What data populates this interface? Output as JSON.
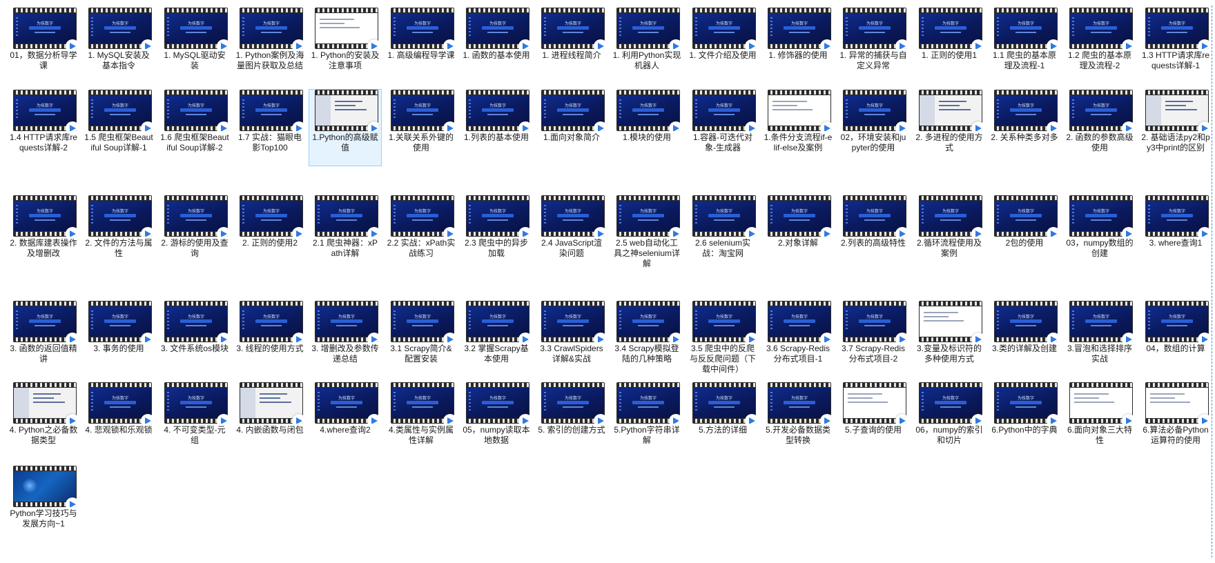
{
  "files": [
    {
      "name": "01，数据分析导学课",
      "thumb": "slide"
    },
    {
      "name": "1. MySQL安装及基本指令",
      "thumb": "slide"
    },
    {
      "name": "1. MySQL驱动安装",
      "thumb": "slide"
    },
    {
      "name": "1. Python案例及海量图片获取及总结",
      "thumb": "slide"
    },
    {
      "name": "1. Python的安装及注意事项",
      "thumb": "doc"
    },
    {
      "name": "1. 高级编程导学课",
      "thumb": "slide"
    },
    {
      "name": "1. 函数的基本使用",
      "thumb": "slide"
    },
    {
      "name": "1. 进程线程简介",
      "thumb": "slide"
    },
    {
      "name": "1. 利用Python实现机器人",
      "thumb": "slide"
    },
    {
      "name": "1. 文件介绍及使用",
      "thumb": "slide"
    },
    {
      "name": "1. 修饰器的使用",
      "thumb": "slide"
    },
    {
      "name": "1. 异常的捕获与自定义异常",
      "thumb": "slide"
    },
    {
      "name": "1. 正则的使用1",
      "thumb": "slide"
    },
    {
      "name": "1.1 爬虫的基本原理及流程-1",
      "thumb": "slide"
    },
    {
      "name": "1.2 爬虫的基本原理及流程-2",
      "thumb": "slide"
    },
    {
      "name": "1.3 HTTP请求库requests详解-1",
      "thumb": "slide"
    },
    {
      "name": "1.4 HTTP请求库requests详解-2",
      "thumb": "slide"
    },
    {
      "name": "1.5 爬虫框架Beautiful Soup详解-1",
      "thumb": "slide"
    },
    {
      "name": "1.6 爬虫框架Beautiful Soup详解-2",
      "thumb": "slide"
    },
    {
      "name": "1.7 实战：猫眼电影Top100",
      "thumb": "slide"
    },
    {
      "name": "1.Python的高级赋值",
      "thumb": "split",
      "selected": true
    },
    {
      "name": "1.关联关系外键的使用",
      "thumb": "slide"
    },
    {
      "name": "1.列表的基本使用",
      "thumb": "slide"
    },
    {
      "name": "1.面向对象简介",
      "thumb": "slide"
    },
    {
      "name": "1.模块的使用",
      "thumb": "slide"
    },
    {
      "name": "1.容器-可迭代对象-生成器",
      "thumb": "slide"
    },
    {
      "name": "1.条件分支流程if-elif-else及案例",
      "thumb": "doc"
    },
    {
      "name": "02，环境安装和jupyter的使用",
      "thumb": "slide"
    },
    {
      "name": "2. 多进程的使用方式",
      "thumb": "split"
    },
    {
      "name": "2. 关系种类多对多",
      "thumb": "slide"
    },
    {
      "name": "2. 函数的参数高级使用",
      "thumb": "slide"
    },
    {
      "name": "2. 基础语法py2和py3中print的区别",
      "thumb": "split"
    },
    {
      "name": "2. 数据库建表操作及增删改",
      "thumb": "slide"
    },
    {
      "name": "2. 文件的方法与属性",
      "thumb": "slide"
    },
    {
      "name": "2. 游标的使用及查询",
      "thumb": "slide"
    },
    {
      "name": "2. 正则的使用2",
      "thumb": "slide"
    },
    {
      "name": "2.1 爬虫神器：xPath详解",
      "thumb": "slide"
    },
    {
      "name": "2.2 实战：xPath实战练习",
      "thumb": "slide"
    },
    {
      "name": "2.3 爬虫中的异步加载",
      "thumb": "slide"
    },
    {
      "name": "2.4 JavaScript渲染问题",
      "thumb": "slide"
    },
    {
      "name": "2.5 web自动化工具之神selenium详解",
      "thumb": "slide"
    },
    {
      "name": "2.6 selenium实战：淘宝网",
      "thumb": "slide"
    },
    {
      "name": "2.对象详解",
      "thumb": "slide"
    },
    {
      "name": "2.列表的高级特性",
      "thumb": "slide"
    },
    {
      "name": "2.循环流程使用及案例",
      "thumb": "slide"
    },
    {
      "name": "2包的使用",
      "thumb": "slide"
    },
    {
      "name": "03，numpy数组的创建",
      "thumb": "slide"
    },
    {
      "name": "3. where查询1",
      "thumb": "slide"
    },
    {
      "name": "3. 函数的返回值精讲",
      "thumb": "slide"
    },
    {
      "name": "3. 事务的使用",
      "thumb": "slide"
    },
    {
      "name": "3. 文件系统os模块",
      "thumb": "slide"
    },
    {
      "name": "3. 线程的使用方式",
      "thumb": "slide"
    },
    {
      "name": "3. 增删改及参数传递总结",
      "thumb": "slide"
    },
    {
      "name": "3.1 Scrapy简介&配置安装",
      "thumb": "slide"
    },
    {
      "name": "3.2 掌握Scrapy基本使用",
      "thumb": "slide"
    },
    {
      "name": "3.3 CrawlSpiders详解&实战",
      "thumb": "slide"
    },
    {
      "name": "3.4 Scrapy模拟登陆的几种策略",
      "thumb": "slide"
    },
    {
      "name": "3.5 爬虫中的反爬与反反爬问题（下载中间件）",
      "thumb": "slide"
    },
    {
      "name": "3.6 Scrapy-Redis分布式项目-1",
      "thumb": "slide"
    },
    {
      "name": "3.7 Scrapy-Redis分布式项目-2",
      "thumb": "slide"
    },
    {
      "name": "3.变量及标识符的多种使用方式",
      "thumb": "doc"
    },
    {
      "name": "3.类的详解及创建",
      "thumb": "slide"
    },
    {
      "name": "3.冒泡和选择排序实战",
      "thumb": "slide"
    },
    {
      "name": "04，数组的计算",
      "thumb": "slide"
    },
    {
      "name": "4. Python之必备数据类型",
      "thumb": "split"
    },
    {
      "name": "4. 悲观锁和乐观锁",
      "thumb": "slide"
    },
    {
      "name": "4. 不可变类型-元组",
      "thumb": "slide"
    },
    {
      "name": "4. 内嵌函数与闭包",
      "thumb": "split"
    },
    {
      "name": "4.where查询2",
      "thumb": "slide"
    },
    {
      "name": "4.类属性与实例属性详解",
      "thumb": "slide"
    },
    {
      "name": "05，numpy读取本地数据",
      "thumb": "slide"
    },
    {
      "name": "5. 索引的创建方式",
      "thumb": "slide"
    },
    {
      "name": "5.Python字符串详解",
      "thumb": "slide"
    },
    {
      "name": "5.方法的详细",
      "thumb": "slide"
    },
    {
      "name": "5.开发必备数据类型转换",
      "thumb": "slide"
    },
    {
      "name": "5.子查询的使用",
      "thumb": "doc"
    },
    {
      "name": "06，numpy的索引和切片",
      "thumb": "slide"
    },
    {
      "name": "6.Python中的字典",
      "thumb": "slide"
    },
    {
      "name": "6.面向对象三大特性",
      "thumb": "doc"
    },
    {
      "name": "6.算法必备Python运算符的使用",
      "thumb": "doc"
    },
    {
      "name": "Python学习技巧与发展方向~1",
      "thumb": "desk"
    }
  ],
  "thumb_slide": {
    "logo": "为技数字",
    "banner": "Python零基础到精通"
  }
}
